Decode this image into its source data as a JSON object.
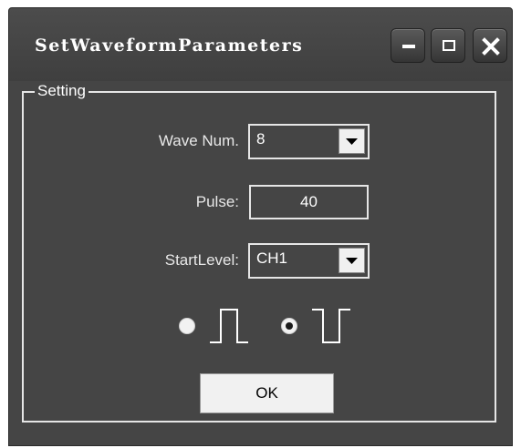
{
  "window": {
    "title": "SetWaveformParameters"
  },
  "setting": {
    "legend": "Setting",
    "wave_num": {
      "label": "Wave Num.",
      "value": "8"
    },
    "pulse": {
      "label": "Pulse:",
      "value": "40"
    },
    "start_level": {
      "label": "StartLevel:",
      "value": "CH1"
    },
    "waveform_options": [
      {
        "name": "positive-pulse",
        "selected": false
      },
      {
        "name": "negative-pulse",
        "selected": true
      }
    ],
    "ok_label": "OK"
  },
  "colors": {
    "window_bg": "#454545",
    "border_light": "#e6e6e6",
    "text": "#ffffff"
  }
}
